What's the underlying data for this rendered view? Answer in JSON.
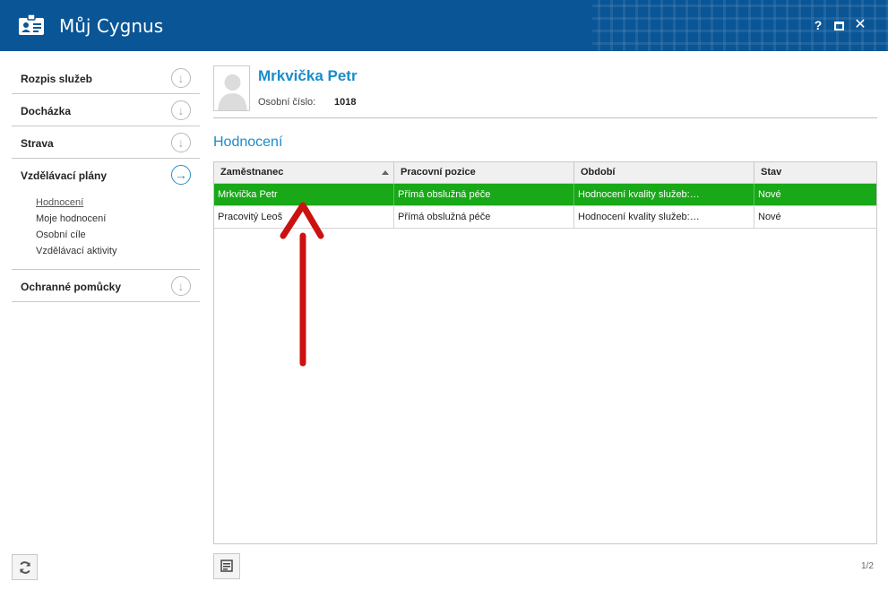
{
  "window": {
    "title": "Můj Cygnus",
    "help_label": "?",
    "close_label": "✕"
  },
  "sidebar": {
    "items": [
      {
        "label": "Rozpis služeb",
        "icon": "arrow-down-circle-icon"
      },
      {
        "label": "Docházka",
        "icon": "arrow-down-circle-icon"
      },
      {
        "label": "Strava",
        "icon": "arrow-down-circle-icon"
      },
      {
        "label": "Vzdělávací plány",
        "icon": "arrow-right-circle-icon",
        "active": true
      },
      {
        "label": "Ochranné pomůcky",
        "icon": "arrow-down-circle-icon"
      }
    ],
    "subitems": [
      {
        "label": "Hodnocení",
        "current": true
      },
      {
        "label": "Moje hodnocení"
      },
      {
        "label": "Osobní cíle"
      },
      {
        "label": "Vzdělávací aktivity"
      }
    ]
  },
  "profile": {
    "name": "Mrkvička Petr",
    "id_label": "Osobní číslo:",
    "id_value": "1018"
  },
  "section": {
    "title": "Hodnocení"
  },
  "table": {
    "columns": [
      "Zaměstnanec",
      "Pracovní pozice",
      "Období",
      "Stav"
    ],
    "sorted_column": "Zaměstnanec",
    "rows": [
      {
        "employee": "Mrkvička Petr",
        "position": "Přímá obslužná péče",
        "period": "Hodnocení kvality služeb:…",
        "status": "Nové",
        "selected": true
      },
      {
        "employee": "Pracovitý Leoš",
        "position": "Přímá obslužná péče",
        "period": "Hodnocení kvality služeb:…",
        "status": "Nové",
        "selected": false
      }
    ]
  },
  "footer": {
    "page": "1/2"
  },
  "colors": {
    "titlebar": "#0a5596",
    "accent": "#1a8cc9",
    "selected_row": "#18a818",
    "annotation_arrow": "#cc1111"
  }
}
